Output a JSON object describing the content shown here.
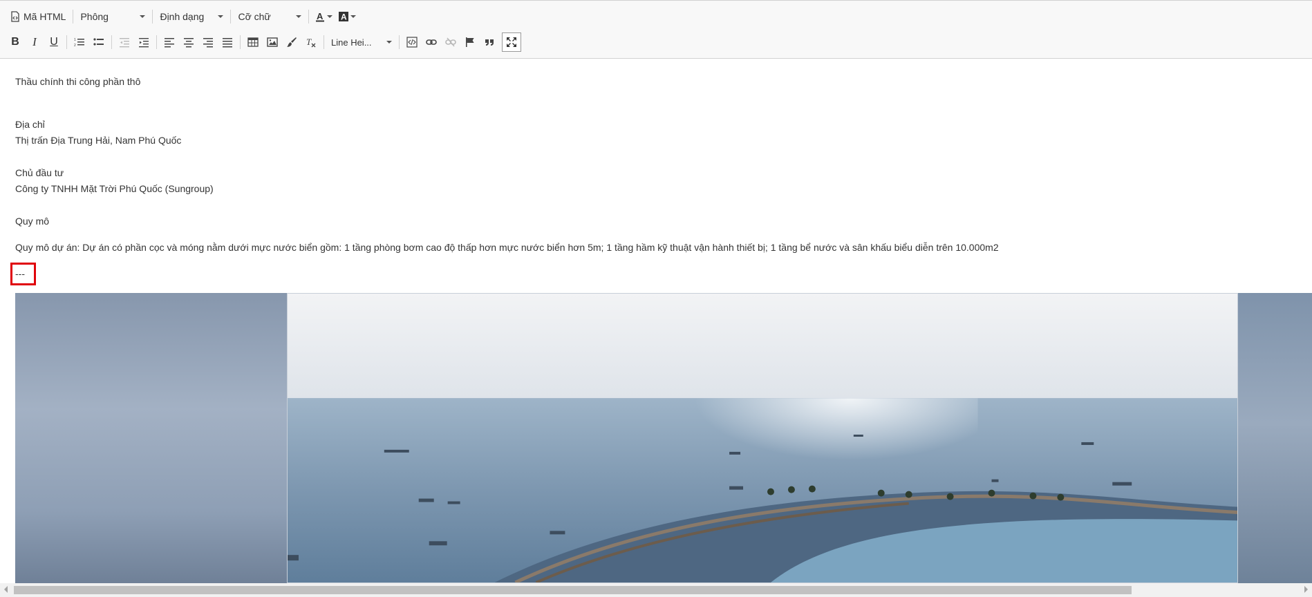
{
  "toolbar": {
    "html_source_label": "Mã HTML",
    "font_label": "Phông",
    "format_label": "Định dạng",
    "size_label": "Cỡ chữ",
    "line_height_label": "Line Hei..."
  },
  "content": {
    "paragraphs": [
      "Thầu chính thi công phần thô",
      "Địa chỉ",
      "Thị trấn Địa Trung Hải, Nam Phú Quốc",
      "Chủ đầu tư",
      "Công ty TNHH Mặt Trời Phú Quốc (Sungroup)",
      "Quy mô",
      "Quy mô dự án: Dự án có phần cọc và móng nằm dưới mực nước biển gồm: 1 tầng phòng bơm cao độ thấp hơn mực nước biển hơn 5m; 1 tầng hầm kỹ thuật vận hành thiết bị; 1 tầng bể nước và sân khấu biểu diễn trên 10.000m2",
      "---"
    ]
  },
  "colors": {
    "highlight_border": "#e0000a",
    "toolbar_bg": "#f8f8f8"
  }
}
